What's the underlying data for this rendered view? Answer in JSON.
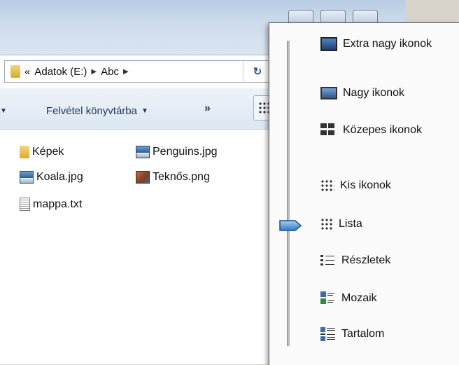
{
  "address": {
    "overflow": "«",
    "drive": "Adatok (E:)",
    "folder": "Abc"
  },
  "toolbar": {
    "library_label": "Felvétel könyvtárba",
    "more": "»"
  },
  "files": [
    {
      "name": "Képek",
      "icon": "folder-icon"
    },
    {
      "name": "Penguins.jpg",
      "icon": "image-icon"
    },
    {
      "name": "Koala.jpg",
      "icon": "image-icon"
    },
    {
      "name": "Teknős.png",
      "icon": "image-icon"
    },
    {
      "name": "mappa.txt",
      "icon": "text-file-icon"
    }
  ],
  "view_menu": {
    "items": [
      {
        "label": "Extra nagy ikonok",
        "icon": "extra-large-icons-icon"
      },
      {
        "label": "Nagy ikonok",
        "icon": "large-icons-icon"
      },
      {
        "label": "Közepes ikonok",
        "icon": "medium-icons-icon"
      },
      {
        "label": "Kis ikonok",
        "icon": "small-icons-icon"
      },
      {
        "label": "Lista",
        "icon": "list-icon"
      },
      {
        "label": "Részletek",
        "icon": "details-icon"
      },
      {
        "label": "Mozaik",
        "icon": "tiles-icon"
      },
      {
        "label": "Tartalom",
        "icon": "content-icon"
      }
    ],
    "selected": "Lista"
  }
}
